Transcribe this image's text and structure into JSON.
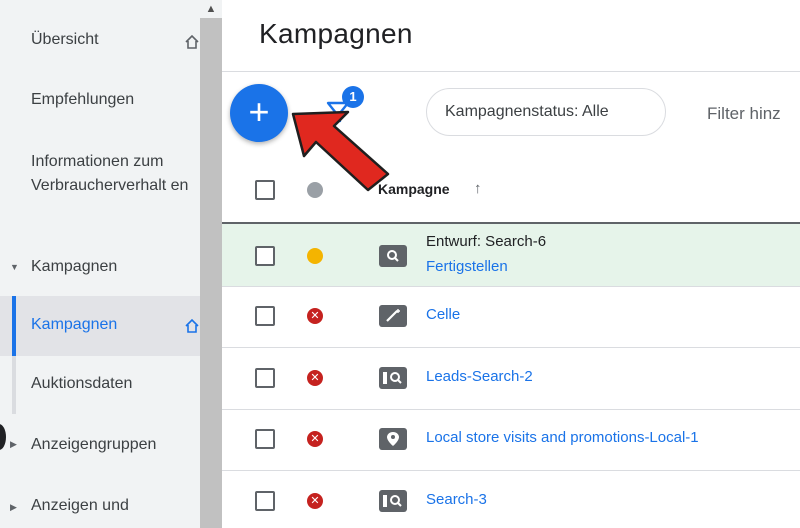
{
  "sidebar": {
    "items": [
      {
        "label": "Übersicht"
      },
      {
        "label": "Empfehlungen"
      },
      {
        "label": "Informationen zum Verbraucherverhalt en"
      },
      {
        "label": "Kampagnen"
      },
      {
        "label": "Kampagnen"
      },
      {
        "label": "Auktionsdaten"
      },
      {
        "label": "Anzeigengruppen"
      },
      {
        "label": "Anzeigen und"
      }
    ]
  },
  "main": {
    "title": "Kampagnen",
    "filter_badge": "1",
    "status_chip": "Kampagnenstatus: Alle",
    "filter_add": "Filter hinz",
    "column_header": "Kampagne",
    "rows": [
      {
        "status": "draft",
        "name": "Entwurf: Search-6",
        "action": "Fertigstellen",
        "icon": "search-campaign-icon"
      },
      {
        "status": "removed",
        "name": "Celle",
        "icon": "smart-campaign-icon"
      },
      {
        "status": "removed",
        "name": "Leads-Search-2",
        "icon": "search-campaign-icon"
      },
      {
        "status": "removed",
        "name": "Local store visits and promotions-Local-1",
        "icon": "local-campaign-icon"
      },
      {
        "status": "removed",
        "name": "Search-3",
        "icon": "search-campaign-icon"
      }
    ]
  },
  "colors": {
    "accent": "#1a73e8",
    "removed": "#c5221f",
    "draft": "#f4b400",
    "draft_row_bg": "#e6f4ea",
    "arrow": "#e0281f"
  }
}
